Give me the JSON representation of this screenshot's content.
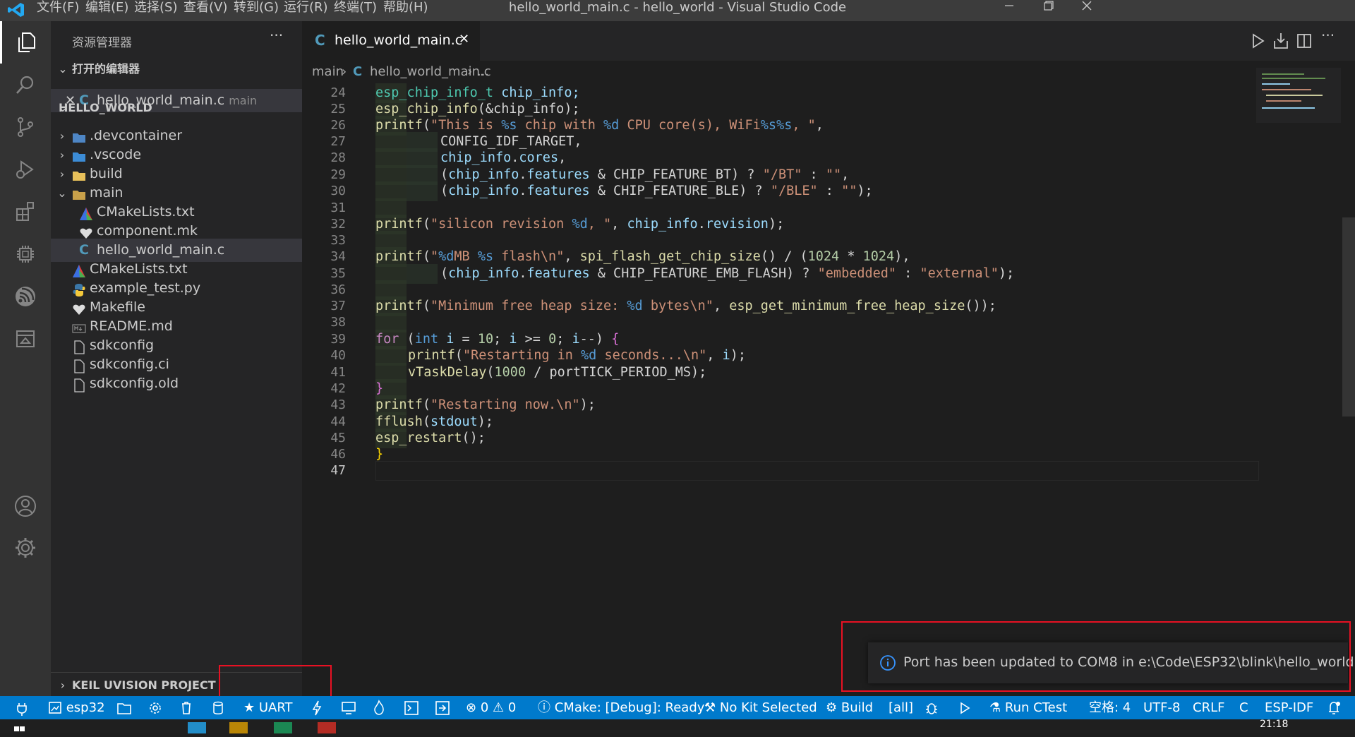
{
  "titlebar": {
    "menus": [
      "文件(F)",
      "编辑(E)",
      "选择(S)",
      "查看(V)",
      "转到(G)",
      "运行(R)",
      "终端(T)",
      "帮助(H)"
    ],
    "window_title": "hello_world_main.c - hello_world - Visual Studio Code"
  },
  "sidebar": {
    "title": "资源管理器",
    "more": "···",
    "open_editors_header": "打开的编辑器",
    "open_editor": {
      "name": "hello_world_main.c",
      "desc": "main"
    },
    "project_header": "HELLO_WORLD",
    "tree": [
      {
        "name": ".devcontainer",
        "icon": "folder-devcontainer-icon"
      },
      {
        "name": ".vscode",
        "icon": "folder-vscode-icon"
      },
      {
        "name": "build",
        "icon": "folder-icon"
      },
      {
        "name": "main",
        "icon": "folder-open-icon"
      },
      {
        "name": "CMakeLists.txt",
        "icon": "cmake-icon"
      },
      {
        "name": "component.mk",
        "icon": "makefile-icon"
      },
      {
        "name": "hello_world_main.c",
        "icon": "c-file-icon"
      },
      {
        "name": "CMakeLists.txt",
        "icon": "cmake-icon"
      },
      {
        "name": "example_test.py",
        "icon": "python-icon"
      },
      {
        "name": "Makefile",
        "icon": "makefile-icon"
      },
      {
        "name": "README.md",
        "icon": "markdown-icon"
      },
      {
        "name": "sdkconfig",
        "icon": "file-icon"
      },
      {
        "name": "sdkconfig.ci",
        "icon": "file-icon"
      },
      {
        "name": "sdkconfig.old",
        "icon": "file-icon"
      }
    ],
    "keil_header": "KEIL UVISION PROJECT"
  },
  "editor": {
    "tab_label": "hello_world_main.c",
    "breadcrumb": {
      "folder": "main",
      "file": "hello_world_main.c",
      "tail": "..."
    },
    "line_numbers": [
      "24",
      "25",
      "26",
      "27",
      "28",
      "29",
      "30",
      "31",
      "32",
      "33",
      "34",
      "35",
      "36",
      "37",
      "38",
      "39",
      "40",
      "41",
      "42",
      "43",
      "44",
      "45",
      "46",
      "47"
    ],
    "lines": {
      "l24": [
        "esp_chip_info_t",
        " chip_info;"
      ],
      "l25": [
        "esp_chip_info",
        "(&chip_info);"
      ],
      "l26": [
        "printf",
        "(",
        "\"This is ",
        "%s",
        " chip with ",
        "%d",
        " CPU core(s), WiFi",
        "%s%s",
        ", \"",
        ","
      ],
      "l27": [
        "CONFIG_IDF_TARGET,"
      ],
      "l28": [
        "chip_info",
        ".",
        "cores",
        ","
      ],
      "l29": [
        "(",
        "chip_info",
        ".",
        "features",
        " & CHIP_FEATURE_BT) ? ",
        "\"/BT\"",
        " : ",
        "\"\"",
        ","
      ],
      "l30": [
        "(",
        "chip_info",
        ".",
        "features",
        " & CHIP_FEATURE_BLE) ? ",
        "\"/BLE\"",
        " : ",
        "\"\"",
        ");"
      ],
      "l32": [
        "printf",
        "(",
        "\"silicon revision ",
        "%d",
        ", \"",
        ", ",
        "chip_info",
        ".",
        "revision",
        ");"
      ],
      "l34": [
        "printf",
        "(",
        "\"",
        "%d",
        "MB ",
        "%s",
        " flash\\n\"",
        ", ",
        "spi_flash_get_chip_size",
        "() / (",
        "1024",
        " * ",
        "1024",
        "),"
      ],
      "l35": [
        "(",
        "chip_info",
        ".",
        "features",
        " & CHIP_FEATURE_EMB_FLASH) ? ",
        "\"embedded\"",
        " : ",
        "\"external\"",
        ");"
      ],
      "l37": [
        "printf",
        "(",
        "\"Minimum free heap size: ",
        "%d",
        " bytes\\n\"",
        ", ",
        "esp_get_minimum_free_heap_size",
        "());"
      ],
      "l39": [
        "for",
        " (",
        "int",
        " ",
        "i",
        " = ",
        "10",
        "; ",
        "i",
        " >= ",
        "0",
        "; ",
        "i",
        "--) ",
        "{"
      ],
      "l40": [
        "printf",
        "(",
        "\"Restarting in ",
        "%d",
        " seconds...\\n\"",
        ", ",
        "i",
        ");"
      ],
      "l41": [
        "vTaskDelay",
        "(",
        "1000",
        " / portTICK_PERIOD_MS);"
      ],
      "l42": [
        "}"
      ],
      "l43": [
        "printf",
        "(",
        "\"Restarting now.\\n\"",
        ");"
      ],
      "l44": [
        "fflush",
        "(",
        "stdout",
        ");"
      ],
      "l45": [
        "esp_restart",
        "();"
      ],
      "l46": [
        "}"
      ]
    }
  },
  "statusbar": {
    "target": "esp32",
    "uart": "UART",
    "problems_errors": "0",
    "problems_warnings": "0",
    "cmake": "CMake: [Debug]: Ready",
    "kit": "No Kit Selected",
    "build": "Build",
    "all": "[all]",
    "run_ctest": "Run CTest",
    "spaces": "空格: 4",
    "encoding": "UTF-8",
    "eol": "CRLF",
    "language": "C",
    "idf": "ESP-IDF"
  },
  "notification": {
    "message": "Port has been updated to COM8 in e:\\Code\\ESP32\\blink\\hello_world"
  },
  "taskbar": {
    "time": "21:18"
  },
  "colors": {
    "statusbar": "#007acc",
    "activitybar": "#333333",
    "sidebar": "#252526",
    "editor": "#1e1e1e",
    "highlight_box": "#e81123"
  }
}
